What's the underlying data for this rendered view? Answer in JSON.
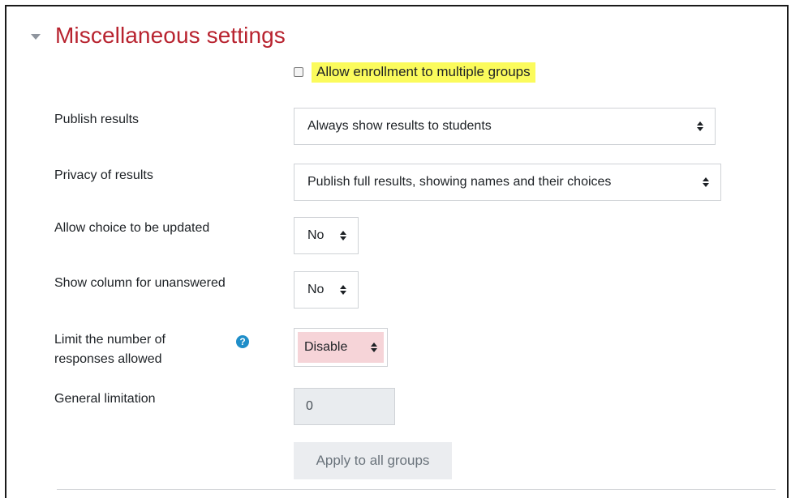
{
  "section": {
    "title": "Miscellaneous settings"
  },
  "allow_multiple_groups": {
    "label": "Allow enrollment to multiple groups",
    "checked": false
  },
  "fields": {
    "publish_results": {
      "label": "Publish results",
      "value": "Always show results to students"
    },
    "privacy_of_results": {
      "label": "Privacy of results",
      "value": "Publish full results, showing names and their choices"
    },
    "allow_update": {
      "label": "Allow choice to be updated",
      "value": "No"
    },
    "show_unanswered": {
      "label": "Show column for unanswered",
      "value": "No"
    },
    "limit_responses": {
      "label_line1": "Limit the number of",
      "label_line2": "responses allowed",
      "value": "Disable",
      "help_icon": "question-circle-icon",
      "help_glyph": "?"
    },
    "general_limitation": {
      "label": "General limitation",
      "value": "0"
    }
  },
  "apply_button": {
    "label": "Apply to all groups"
  },
  "colors": {
    "title": "#b8232f",
    "highlight": "#fbfb5c",
    "disabled_select_bg": "#f6d4d8",
    "help_icon": "#1f8ec9"
  }
}
